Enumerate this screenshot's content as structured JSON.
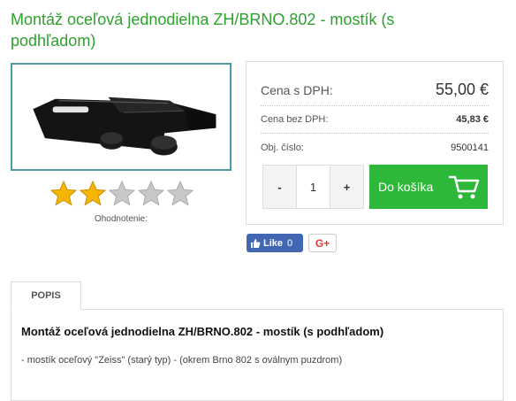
{
  "product": {
    "title": "Montáž oceľová jednodielna ZH/BRNO.802 - mostík (s podhľadom)",
    "image_icon": "rifle-scope-mount-image"
  },
  "rating": {
    "filled": 2,
    "max": 5,
    "label": "Ohodnotenie:",
    "filled_color": "#f6b500",
    "empty_color": "#c8c8c8"
  },
  "prices": {
    "with_vat_label": "Cena s DPH:",
    "with_vat_value": "55,00 €",
    "without_vat_label": "Cena bez DPH:",
    "without_vat_value": "45,83 €",
    "code_label": "Obj. číslo:",
    "code_value": "9500141"
  },
  "quantity": {
    "minus": "-",
    "value": "1",
    "plus": "+"
  },
  "cart": {
    "label": "Do košíka",
    "icon": "cart-icon",
    "color": "#2eb839"
  },
  "social": {
    "like_label": "Like",
    "like_count": "0",
    "gplus_label": "G+"
  },
  "tabs": {
    "description_tab": "POPIS"
  },
  "description": {
    "title": "Montáž oceľová jednodielna ZH/BRNO.802 - mostík (s podhľadom)",
    "text": "- mostík oceľový \"Zeiss\" (starý typ) - (okrem Brno 802 s oválnym puzdrom)"
  },
  "colors": {
    "title_green": "#2fa02f",
    "image_border": "#4a9aa8",
    "facebook_blue": "#4267b2",
    "gplus_red": "#d73d32"
  }
}
